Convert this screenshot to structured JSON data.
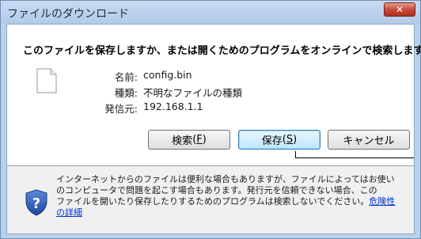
{
  "window": {
    "title": "ファイルのダウンロード",
    "close_label": "✕"
  },
  "dialog": {
    "question": "このファイルを保存しますか、または開くためのプログラムをオンラインで検索しますか?",
    "fields": {
      "name_label": "名前:",
      "name_value": "config.bin",
      "type_label": "種類:",
      "type_value": "不明なファイルの種類",
      "source_label": "発信元:",
      "source_value": "192.168.1.1"
    },
    "buttons": {
      "search_label": "検索",
      "search_key": "F",
      "save_label": "保存",
      "save_key": "S",
      "cancel_label": "キャンセル"
    },
    "footer": {
      "line1": "インターネットからのファイルは便利な場合もありますが、ファイルによってはお使い",
      "line2": "のコンピュータで問題を起こす場合もあります。発行元を信頼できない場合、この",
      "line3": "ファイルを開いたり保存したりするためのプログラムは検索しないでください。",
      "link_part1": "危険性",
      "link_part2": "の詳細"
    }
  },
  "icons": {
    "file": "file-icon",
    "shield": "shield-question-icon",
    "close": "close-icon"
  },
  "colors": {
    "titlebar": "#b9d1ea",
    "close": "#c34734",
    "link": "#0033cc"
  }
}
